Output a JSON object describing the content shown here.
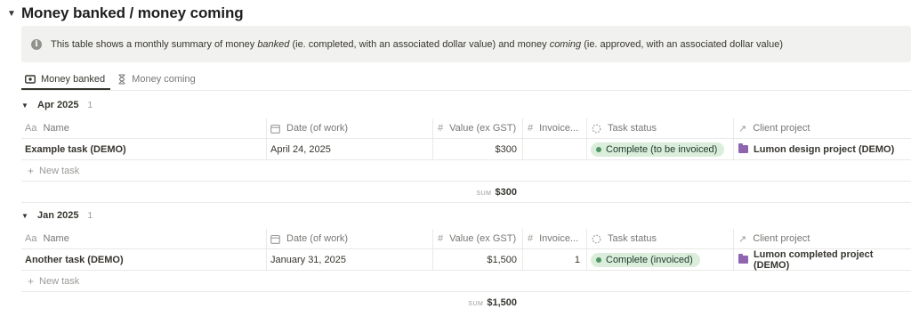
{
  "page": {
    "title": "Money banked / money coming"
  },
  "callout": {
    "icon": "info-icon",
    "text_before": "This table shows a monthly summary of money ",
    "em1": "banked",
    "text_middle": " (ie. completed, with an associated dollar value) and money ",
    "em2": "coming",
    "text_after": " (ie. approved, with an associated dollar value)"
  },
  "tabs": [
    {
      "label": "Money banked",
      "icon": "money-icon",
      "active": true
    },
    {
      "label": "Money coming",
      "icon": "hourglass-icon",
      "active": false
    }
  ],
  "columns": {
    "name": {
      "label": "Name",
      "icon": "Aa"
    },
    "date": {
      "label": "Date (of work)",
      "icon": "calendar-icon"
    },
    "value": {
      "label": "Value (ex GST)",
      "icon": "#"
    },
    "invoice": {
      "label": "Invoice...",
      "icon": "#"
    },
    "status": {
      "label": "Task status",
      "icon": "status-icon"
    },
    "client": {
      "label": "Client project",
      "icon": "relation-arrow-icon"
    }
  },
  "groups": [
    {
      "name": "Apr 2025",
      "count": "1",
      "row": {
        "name": "Example task (DEMO)",
        "date": "April 24, 2025",
        "value": "$300",
        "invoice": "",
        "status": "Complete (to be invoiced)",
        "client": "Lumon design project (DEMO)"
      },
      "new_label": "New task",
      "sum_label": "SUM",
      "sum_value": "$300"
    },
    {
      "name": "Jan 2025",
      "count": "1",
      "row": {
        "name": "Another task (DEMO)",
        "date": "January 31, 2025",
        "value": "$1,500",
        "invoice": "1",
        "status": "Complete (invoiced)",
        "client": "Lumon completed project (DEMO)"
      },
      "new_label": "New task",
      "sum_label": "SUM",
      "sum_value": "$1,500"
    }
  ],
  "colors": {
    "status_pill_bg": "#dbeddb",
    "status_dot": "#4f9768",
    "folder": "#9065b0",
    "callout_bg": "#f1f1ef"
  }
}
